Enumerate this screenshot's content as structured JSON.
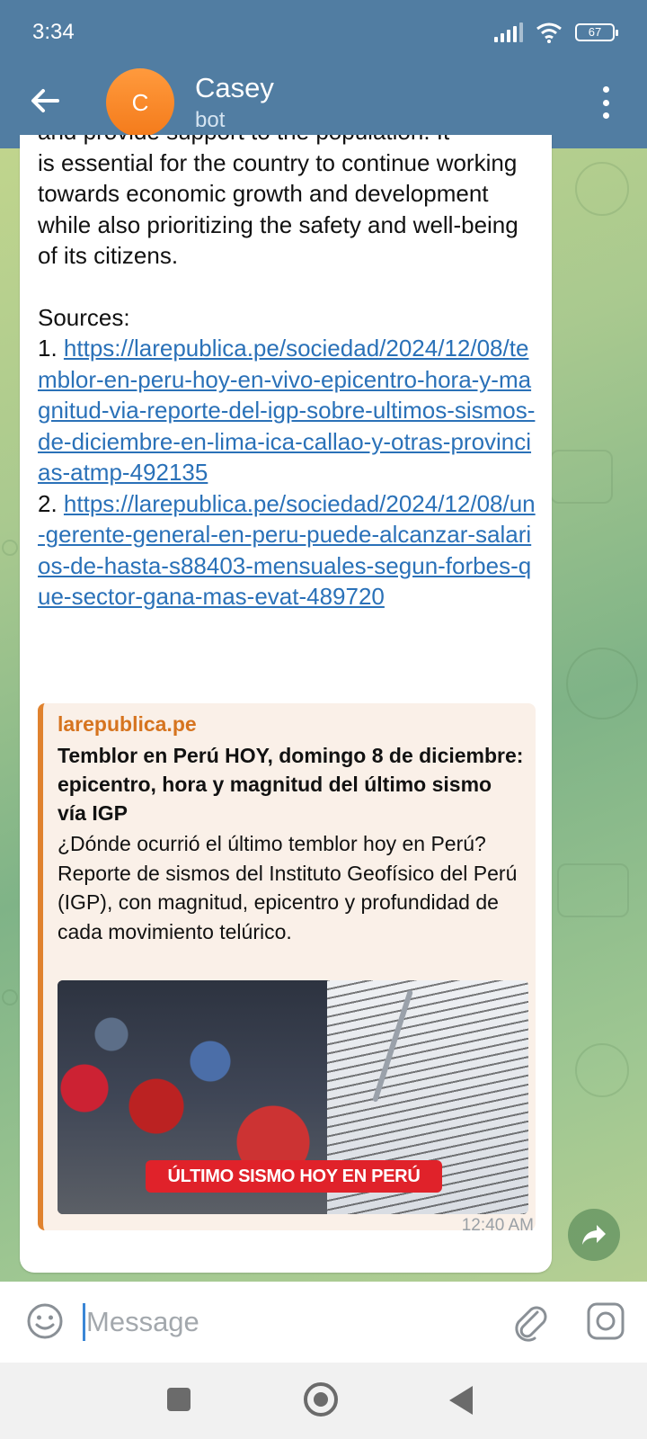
{
  "status": {
    "time": "3:34",
    "battery": "67"
  },
  "header": {
    "name": "Casey",
    "subtitle": "bot",
    "avatar_letter": "C"
  },
  "message": {
    "cut_line": "and provide support to the population. It",
    "body": "is essential for the country to continue working towards economic growth and development while also prioritizing the safety and well-being of its citizens.",
    "sources_label": "Sources",
    "sources": [
      {
        "num": "1. ",
        "url": "https://larepublica.pe/sociedad/2024/12/08/temblor-en-peru-hoy-en-vivo-epicentro-hora-y-magnitud-via-reporte-del-igp-sobre-ultimos-sismos-de-diciembre-en-lima-ica-callao-y-otras-provincias-atmp-492135"
      },
      {
        "num": "2. ",
        "url": "https://larepublica.pe/sociedad/2024/12/08/un-gerente-general-en-peru-puede-alcanzar-salarios-de-hasta-s88403-mensuales-segun-forbes-que-sector-gana-mas-evat-489720"
      }
    ],
    "time": "12:40 AM"
  },
  "preview": {
    "site": "larepublica.pe",
    "title": "Temblor en Perú HOY, domingo 8 de diciembre: epicentro, hora y magnitud del último sismo vía IGP",
    "description": "¿Dónde ocurrió el último temblor hoy en Perú? Reporte de sismos del Instituto Geofísico del Perú (IGP), con magnitud, epicentro y profundidad de cada movimiento telúrico.",
    "image_banner": "ÚLTIMO SISMO HOY EN PERÚ"
  },
  "input": {
    "placeholder": "Message"
  },
  "colors": {
    "header": "#517da2",
    "link": "#2a71b8",
    "preview_accent": "#e0822e"
  }
}
